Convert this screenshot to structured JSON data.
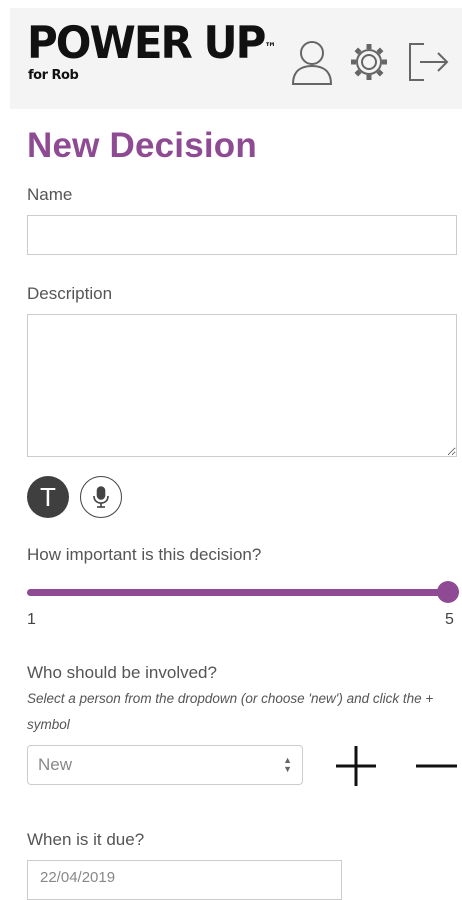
{
  "header": {
    "logo_main": "POWER UP",
    "logo_tm": "™",
    "logo_sub": "for Rob",
    "icons": [
      "user-icon",
      "gear-icon",
      "logout-icon"
    ]
  },
  "page": {
    "title": "New Decision"
  },
  "form": {
    "name_label": "Name",
    "name_value": "",
    "description_label": "Description",
    "description_value": "",
    "text_button_label": "T",
    "importance_label": "How important is this decision?",
    "importance": {
      "min": "1",
      "max": "5",
      "value": 5
    },
    "involved_label": "Who should be involved?",
    "involved_hint": "Select a person from the dropdown (or choose 'new') and click the + symbol",
    "involved_selected": "New",
    "due_label": "When is it due?",
    "due_value": "22/04/2019"
  },
  "colors": {
    "accent": "#8e4b93",
    "header_bg": "#f4f4f4"
  }
}
